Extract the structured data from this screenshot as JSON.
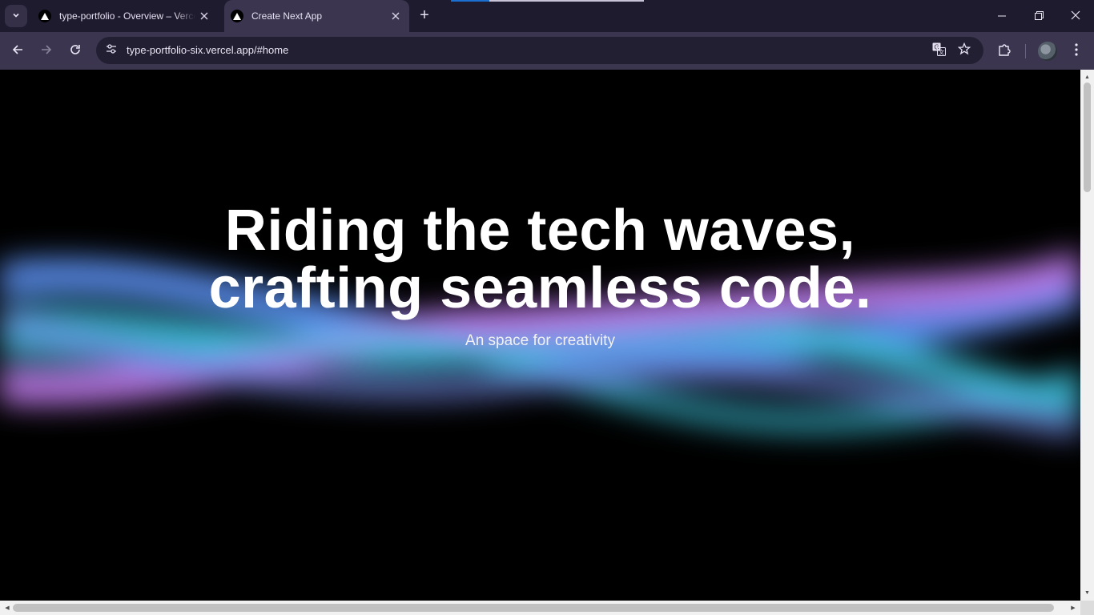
{
  "browser": {
    "tabs": [
      {
        "title": "type-portfolio - Overview – Vercel",
        "active": false
      },
      {
        "title": "Create Next App",
        "active": true
      }
    ],
    "new_tab_label": "+",
    "address_bar": {
      "url": "type-portfolio-six.vercel.app/#home"
    },
    "icons": {
      "tab_search": "chevron-down-icon",
      "tab_favicon": "vercel-triangle-icon",
      "close": "close-icon",
      "back": "arrow-left-icon",
      "forward": "arrow-right-icon",
      "reload": "reload-icon",
      "site_info": "tune-icon",
      "translate": "translate-icon",
      "bookmark": "star-icon",
      "extensions": "puzzle-icon",
      "profile": "avatar",
      "menu": "kebab-menu-icon",
      "minimize": "minimize-icon",
      "restore": "restore-icon",
      "close_window": "close-icon"
    },
    "colors": {
      "tabstrip_bg": "#1f1b2e",
      "toolbar_bg": "#3b3550",
      "omnibox_bg": "#231f33"
    }
  },
  "page": {
    "hero": {
      "title_line1": "Riding the tech waves,",
      "title_line2": "crafting seamless code.",
      "subtitle": "An space for creativity"
    },
    "colors": {
      "background": "#000000",
      "wave_blue": "#5b8ff0",
      "wave_cyan": "#3ec7e0",
      "wave_pink": "#c27cf0"
    }
  }
}
